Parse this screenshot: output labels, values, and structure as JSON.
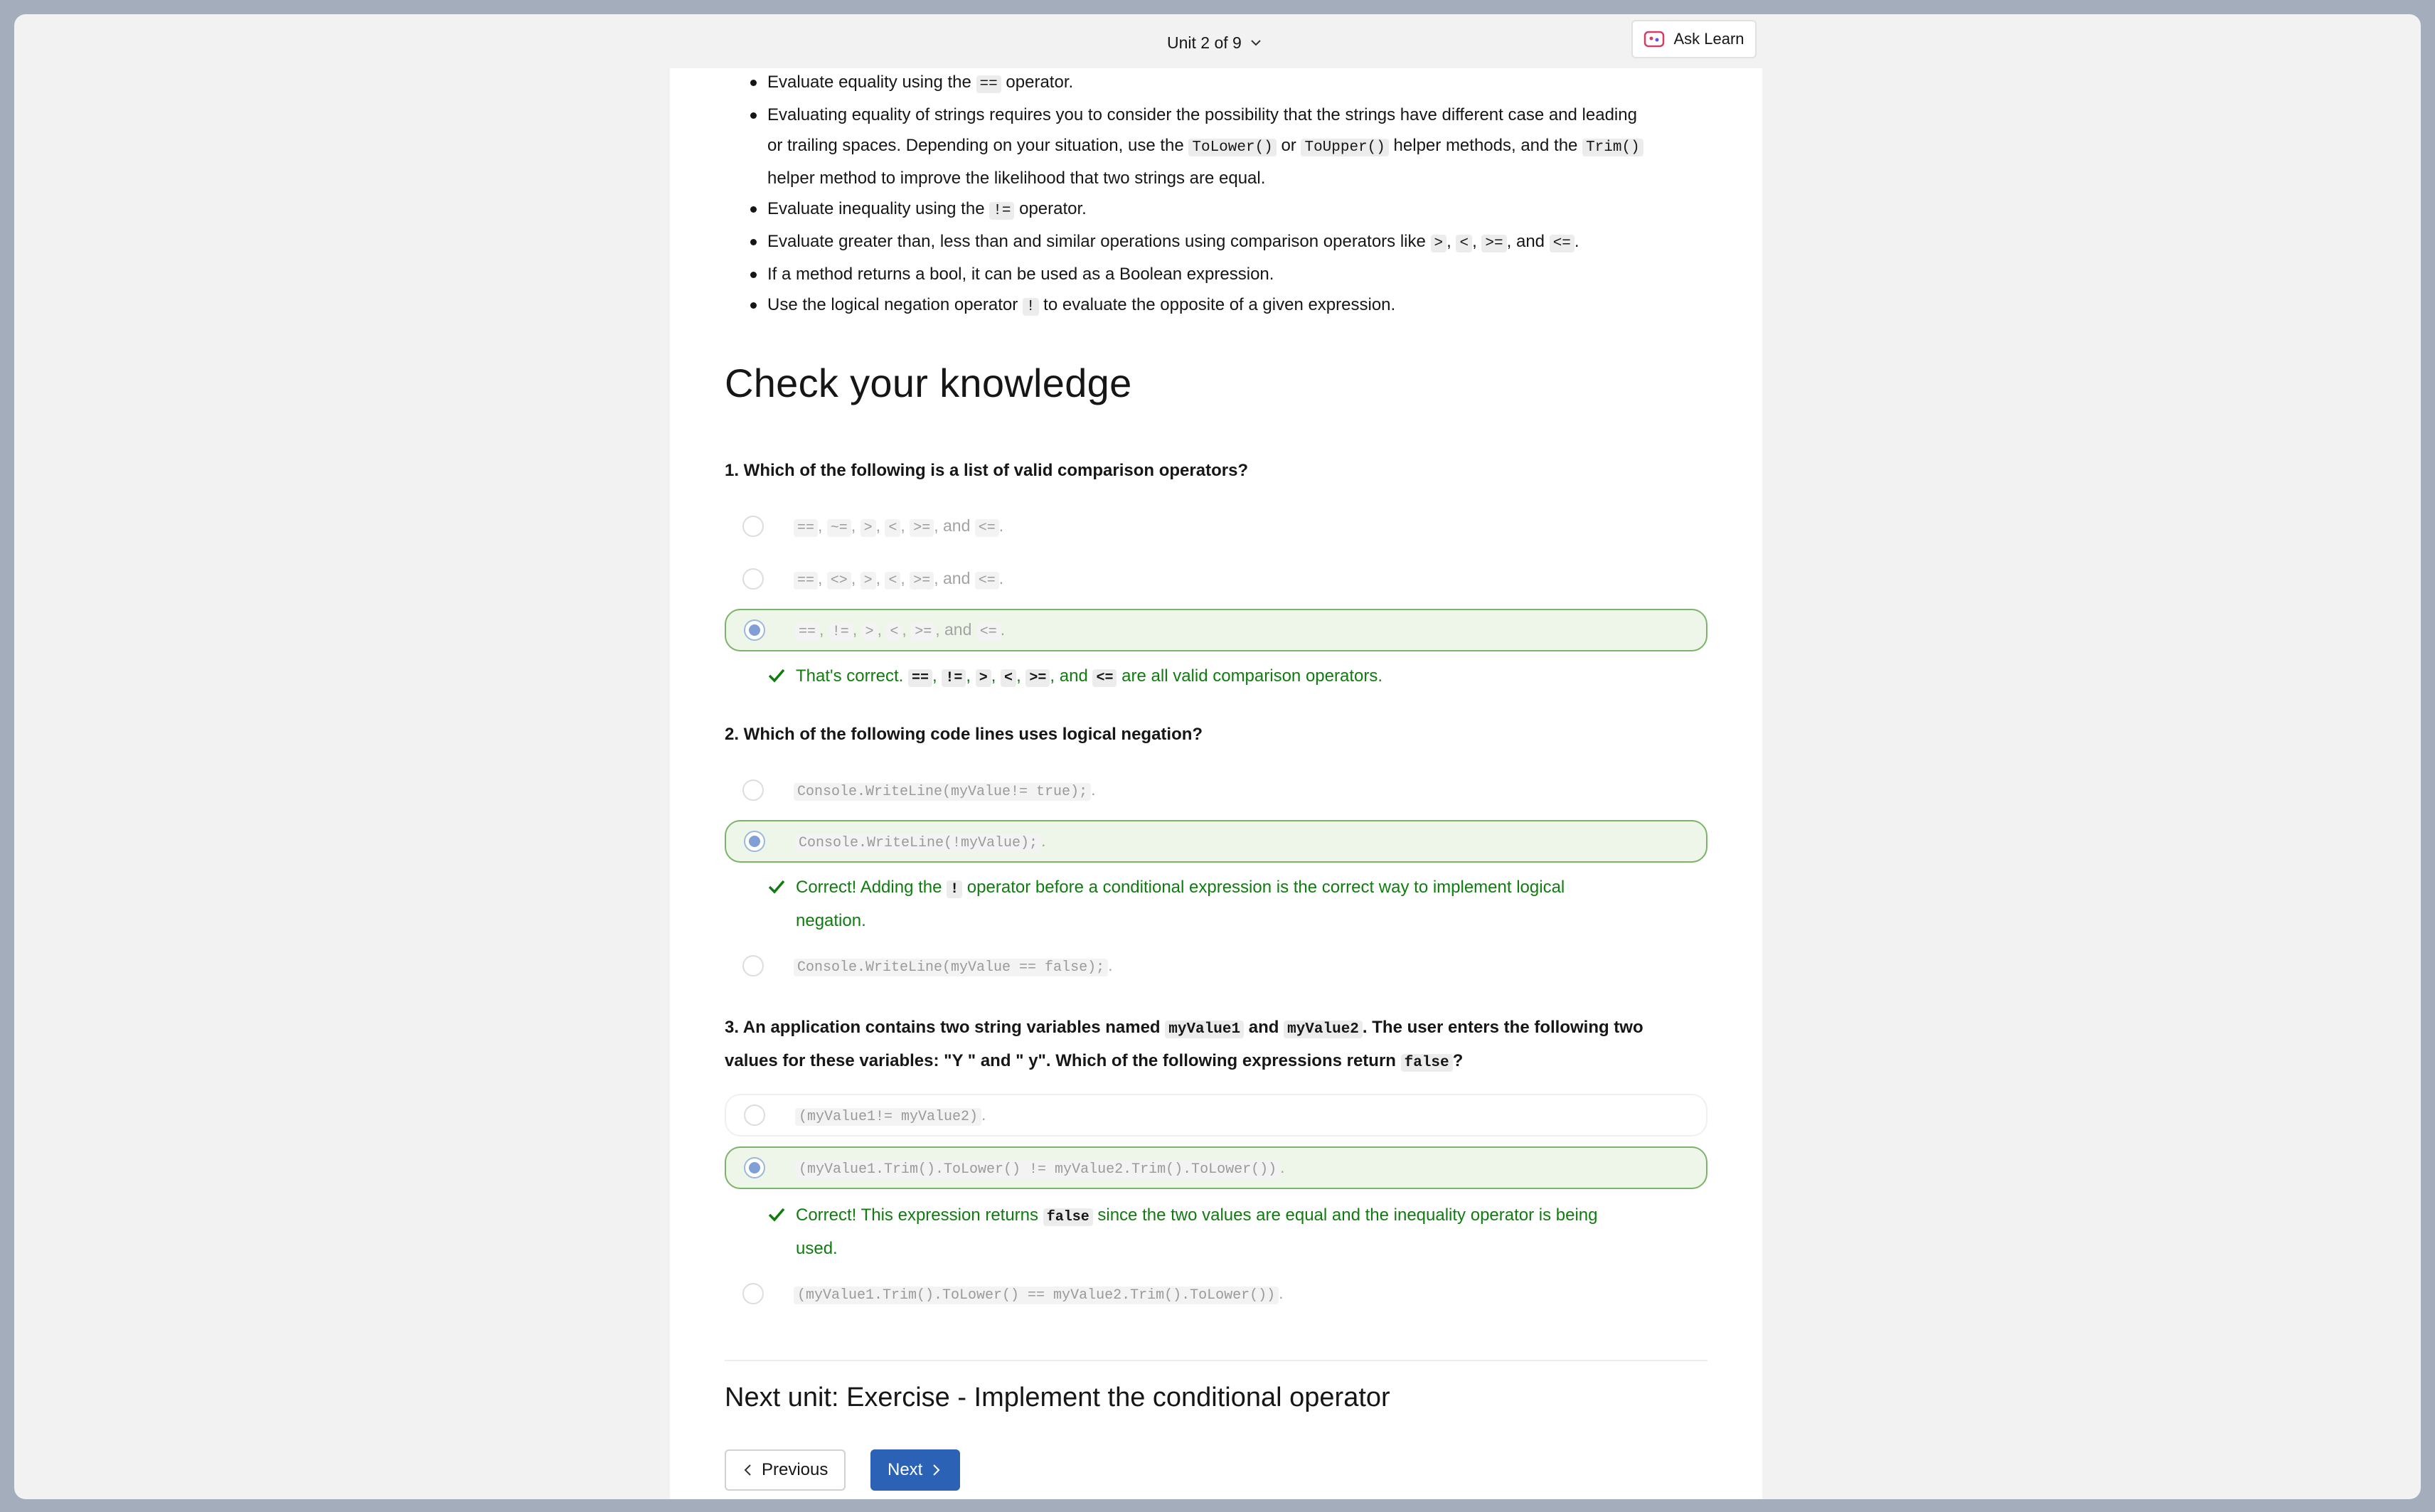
{
  "header": {
    "unit_label": "Unit 2 of 9",
    "ask_learn_label": "Ask Learn"
  },
  "summary": {
    "items": [
      {
        "pre": "Evaluate equality using the ",
        "code1": "==",
        "post": " operator."
      },
      {
        "line1": "Evaluating equality of strings requires you to consider the possibility that the strings have different case and leading",
        "line2_pre": "or trailing spaces. Depending on your situation, use the ",
        "code_lower": "ToLower()",
        "mid": " or ",
        "code_upper": "ToUpper()",
        "mid2": " helper methods, and the ",
        "code_trim": "Trim()",
        "line3": "helper method to improve the likelihood that two strings are equal."
      },
      {
        "pre": "Evaluate inequality using the ",
        "code1": "!=",
        "post": " operator."
      },
      {
        "pre": "Evaluate greater than, less than and similar operations using comparison operators like ",
        "c1": ">",
        "c2": "<",
        "c3": ">=",
        "and": ", and ",
        "c4": "<=",
        "post": "."
      },
      {
        "text": "If a method returns a bool, it can be used as a Boolean expression."
      },
      {
        "pre": "Use the logical negation operator ",
        "code1": "!",
        "post": " to evaluate the opposite of a given expression."
      }
    ]
  },
  "check": {
    "title": "Check your knowledge",
    "q1": {
      "question": "1. Which of the following is a list of valid comparison operators?",
      "options": [
        [
          "==",
          "~=",
          ">",
          "<",
          ">="
        ],
        [
          "==",
          "<>",
          ">",
          "<",
          ">="
        ],
        [
          "==",
          "!=",
          ">",
          "<",
          ">="
        ]
      ],
      "last_op": "<=",
      "and_word": ", and ",
      "selected_index": 2,
      "feedback_pre": "That's correct. ",
      "feedback_codes": [
        "==",
        "!=",
        ">",
        "<",
        ">="
      ],
      "feedback_last": "<=",
      "feedback_post": " are all valid comparison operators."
    },
    "q2": {
      "question": "2. Which of the following code lines uses logical negation?",
      "options": [
        "Console.WriteLine(myValue!= true);",
        "Console.WriteLine(!myValue);",
        "Console.WriteLine(myValue == false);"
      ],
      "selected_index": 1,
      "feedback_pre": "Correct! Adding the ",
      "feedback_code": "!",
      "feedback_post": " operator before a conditional expression is the correct way to implement logical",
      "feedback_line2": "negation."
    },
    "q3": {
      "q_pre": "3. An application contains two string variables named ",
      "var1": "myValue1",
      "q_and": " and ",
      "var2": "myValue2",
      "q_post": ". The user enters the following two",
      "q_line2": "values for these variables: \"Y \" and \" y\". Which of the following expressions return ",
      "q_code": "false",
      "q_end": "?",
      "options": [
        "(myValue1!= myValue2)",
        "(myValue1.Trim().ToLower() != myValue2.Trim().ToLower())",
        "(myValue1.Trim().ToLower() == myValue2.Trim().ToLower())"
      ],
      "selected_index": 1,
      "feedback_pre": "Correct! This expression returns ",
      "feedback_code": "false",
      "feedback_post": " since the two values are equal and the inequality operator is being",
      "feedback_line2": "used."
    }
  },
  "next_unit": {
    "heading": "Next unit: Exercise - Implement the conditional operator",
    "previous_label": "Previous",
    "next_label": "Next"
  },
  "colors": {
    "correct": "#107c10",
    "selected_bg": "#eef6ea",
    "accent": "#2b62b5"
  }
}
